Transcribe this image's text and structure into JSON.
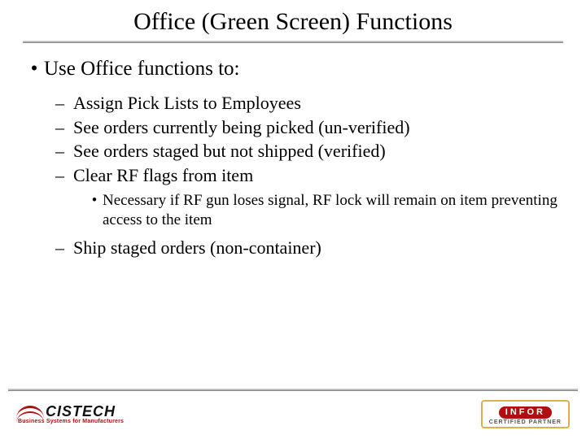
{
  "title": "Office (Green Screen) Functions",
  "intro": "Use Office functions to:",
  "items": [
    "Assign Pick Lists to Employees",
    "See orders currently being picked (un-verified)",
    "See orders staged but not shipped (verified)",
    "Clear RF flags from item"
  ],
  "subnote": "Necessary if RF gun loses signal, RF lock will remain on item preventing access to the item",
  "item5": "Ship staged orders (non-container)",
  "logo": {
    "cistech_name": "CISTECH",
    "cistech_tag": "Business Systems for Manufacturers",
    "infor_name": "INFOR",
    "infor_tag": "CERTIFIED PARTNER"
  }
}
